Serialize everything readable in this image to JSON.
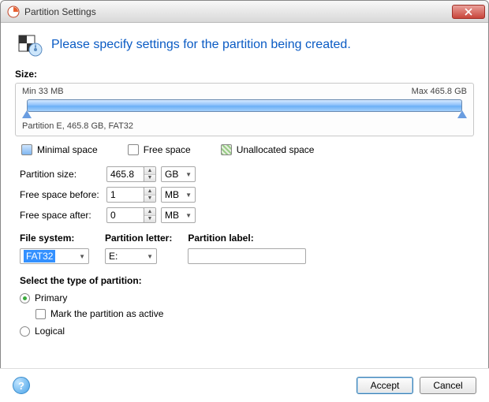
{
  "window": {
    "title": "Partition Settings",
    "heading": "Please specify settings for the partition being created."
  },
  "size_section": {
    "label": "Size:",
    "min": "Min 33 MB",
    "max": "Max 465.8 GB",
    "caption": "Partition E, 465.8 GB, FAT32"
  },
  "legend": {
    "minimal": "Minimal space",
    "free": "Free space",
    "unalloc": "Unallocated space"
  },
  "fields": {
    "partition_size_label": "Partition size:",
    "partition_size_value": "465.8",
    "partition_size_unit": "GB",
    "free_before_label": "Free space before:",
    "free_before_value": "1",
    "free_before_unit": "MB",
    "free_after_label": "Free space after:",
    "free_after_value": "0",
    "free_after_unit": "MB"
  },
  "fs": {
    "label": "File system:",
    "value": "FAT32"
  },
  "letter": {
    "label": "Partition letter:",
    "value": "E:"
  },
  "plabel": {
    "label": "Partition label:",
    "value": ""
  },
  "ptype": {
    "heading": "Select the type of partition:",
    "primary": "Primary",
    "mark_active": "Mark the partition as active",
    "logical": "Logical",
    "selected": "primary",
    "mark_active_checked": false
  },
  "buttons": {
    "accept": "Accept",
    "cancel": "Cancel"
  }
}
